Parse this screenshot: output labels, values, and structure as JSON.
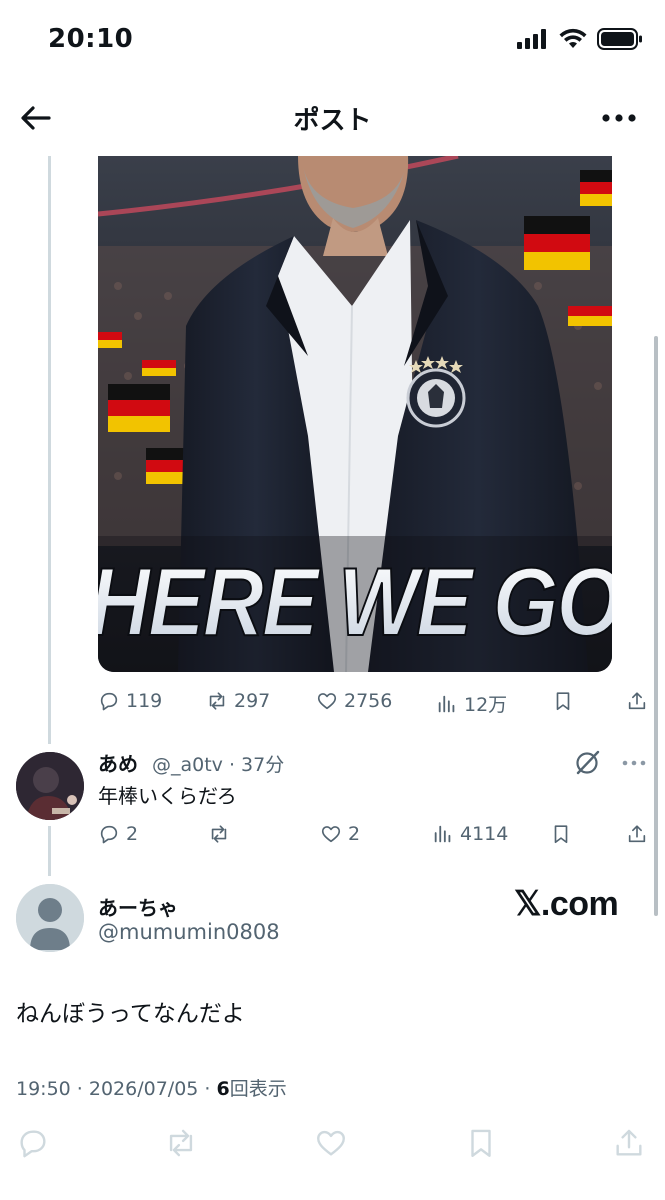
{
  "status_bar": {
    "time": "20:10"
  },
  "header": {
    "title": "ポスト"
  },
  "parent_post": {
    "image": {
      "overlay_text": "HERE WE GO",
      "colors": {
        "jacket": "#1d2230",
        "flag_black": "#111111",
        "flag_red": "#d10a11",
        "flag_gold": "#f2c300"
      }
    },
    "actions": {
      "replies": "119",
      "reposts": "297",
      "likes": "2756",
      "views": "12万"
    }
  },
  "reply": {
    "display_name": "あめ",
    "meta": "@_a0tv · 37分",
    "text": "年棒いくらだろ",
    "actions": {
      "replies": "2",
      "likes": "2",
      "views": "4114"
    }
  },
  "main_post": {
    "display_name": "あーちゃ",
    "handle": "@mumumin0808",
    "text": "ねんぼうってなんだよ",
    "timestamp": "19:50 · 2026/07/05 · ",
    "view_count": "6",
    "view_label": "回表示"
  },
  "watermark": "𝕏.com",
  "icons": [
    "back-arrow-icon",
    "more-icon",
    "reply-icon",
    "repost-icon",
    "like-icon",
    "views-icon",
    "bookmark-icon",
    "share-icon",
    "grok-icon"
  ],
  "colors": {
    "text_primary": "#0f1419",
    "text_secondary": "#536471",
    "thread_line": "#cfd9de"
  }
}
